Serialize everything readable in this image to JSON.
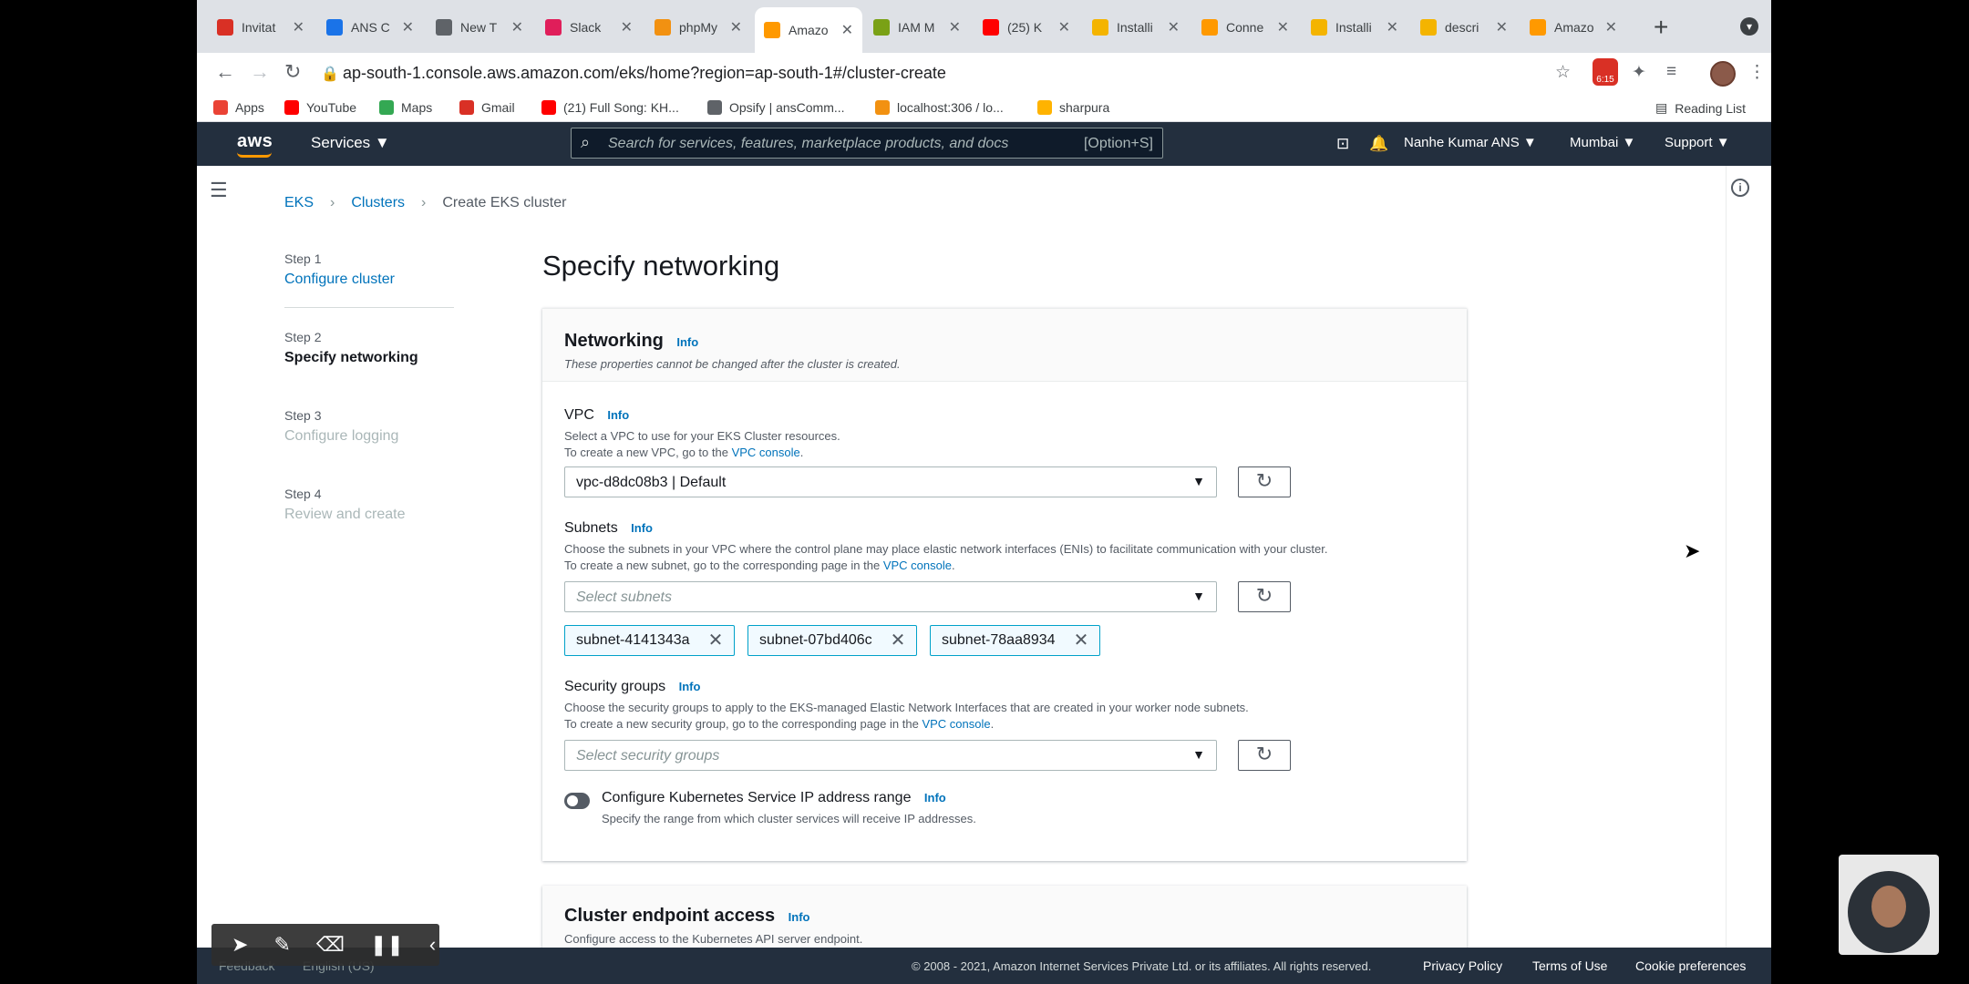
{
  "browser": {
    "tabs": [
      {
        "label": "Invitat",
        "favicon_color": "#d93025"
      },
      {
        "label": "ANS C",
        "favicon_color": "#1a73e8"
      },
      {
        "label": "New T",
        "favicon_color": "#5f6368"
      },
      {
        "label": "Slack",
        "favicon_color": "#e01e5a"
      },
      {
        "label": "phpMy",
        "favicon_color": "#f29111"
      },
      {
        "label": "Amazo",
        "favicon_color": "#ff9900"
      },
      {
        "label": "IAM M",
        "favicon_color": "#7aa116"
      },
      {
        "label": "(25) K",
        "favicon_color": "#ff0000"
      },
      {
        "label": "Installi",
        "favicon_color": "#f4b400"
      },
      {
        "label": "Conne",
        "favicon_color": "#ff9900"
      },
      {
        "label": "Installi",
        "favicon_color": "#f4b400"
      },
      {
        "label": "descri",
        "favicon_color": "#f4b400"
      },
      {
        "label": "Amazo",
        "favicon_color": "#ff9900"
      }
    ],
    "tab_close": "✕",
    "new_tab": "+",
    "url": "ap-south-1.console.aws.amazon.com/eks/home?region=ap-south-1#/cluster-create",
    "ext_badge": "6:15",
    "bookmarks": [
      {
        "label": "Apps",
        "color": "#ea4335"
      },
      {
        "label": "YouTube",
        "color": "#ff0000"
      },
      {
        "label": "Maps",
        "color": "#34a853"
      },
      {
        "label": "Gmail",
        "color": "#d93025"
      },
      {
        "label": "(21) Full Song: KH...",
        "color": "#ff0000"
      },
      {
        "label": "Opsify | ansComm...",
        "color": "#5f6368"
      },
      {
        "label": "localhost:306 / lo...",
        "color": "#f29111"
      },
      {
        "label": "sharpura",
        "color": "#ffb300"
      }
    ],
    "reading_list": "Reading List"
  },
  "aws_nav": {
    "logo": "aws",
    "services": "Services ▼",
    "search_placeholder": "Search for services, features, marketplace products, and docs",
    "search_shortcut": "[Option+S]",
    "user": "Nanhe Kumar ANS ▼",
    "region": "Mumbai ▼",
    "support": "Support ▼"
  },
  "breadcrumb": {
    "items": [
      "EKS",
      "Clusters"
    ],
    "current": "Create EKS cluster",
    "sep": "›"
  },
  "steps": [
    {
      "num": "Step 1",
      "label": "Configure cluster"
    },
    {
      "num": "Step 2",
      "label": "Specify networking"
    },
    {
      "num": "Step 3",
      "label": "Configure logging"
    },
    {
      "num": "Step 4",
      "label": "Review and create"
    }
  ],
  "page_title": "Specify networking",
  "networking": {
    "title": "Networking",
    "info": "Info",
    "desc": "These properties cannot be changed after the cluster is created.",
    "vpc": {
      "label": "VPC",
      "info": "Info",
      "desc1": "Select a VPC to use for your EKS Cluster resources.",
      "desc2_pre": "To create a new VPC, go to the",
      "desc2_link": "VPC console",
      "value": "vpc-d8dc08b3 | Default"
    },
    "subnets": {
      "label": "Subnets",
      "info": "Info",
      "desc1": "Choose the subnets in your VPC where the control plane may place elastic network interfaces (ENIs) to facilitate communication with your cluster.",
      "desc2_pre": "To create a new subnet, go to the corresponding page in the",
      "desc2_link": "VPC console",
      "placeholder": "Select subnets",
      "tokens": [
        "subnet-4141343a",
        "subnet-07bd406c",
        "subnet-78aa8934"
      ]
    },
    "security_groups": {
      "label": "Security groups",
      "info": "Info",
      "desc1": "Choose the security groups to apply to the EKS-managed Elastic Network Interfaces that are created in your worker node subnets.",
      "desc2_pre": "To create a new security group, go to the corresponding page in the",
      "desc2_link": "VPC console",
      "placeholder": "Select security groups"
    },
    "service_ip": {
      "label": "Configure Kubernetes Service IP address range",
      "info": "Info",
      "desc": "Specify the range from which cluster services will receive IP addresses.",
      "enabled": false
    }
  },
  "endpoint": {
    "title": "Cluster endpoint access",
    "info": "Info",
    "desc": "Configure access to the Kubernetes API server endpoint."
  },
  "footer": {
    "feedback": "Feedback",
    "language": "English (US)",
    "copyright": "© 2008 - 2021, Amazon Internet Services Private Ltd. or its affiliates. All rights reserved.",
    "privacy": "Privacy Policy",
    "terms": "Terms of Use",
    "cookies": "Cookie preferences"
  },
  "colors": {
    "aws_nav": "#232f3e",
    "link": "#0073bb",
    "accent": "#ff9900"
  }
}
